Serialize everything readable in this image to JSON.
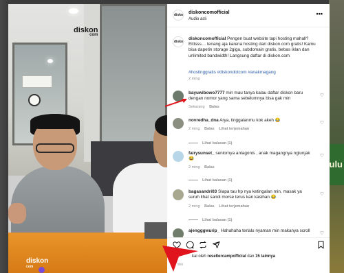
{
  "photo": {
    "logo_top": "diskon",
    "logo_top_sub": "com",
    "logo_bottom": "diskon",
    "logo_bottom_sub": "com"
  },
  "backdrop": {
    "right_text": "ulu"
  },
  "header": {
    "avatar_text": "diskon",
    "username": "diskoncomofficial",
    "subtitle": "Audio asli",
    "more_icon": "more-horizontal-icon",
    "more_label": "•••"
  },
  "caption": {
    "avatar_text": "diskon",
    "username": "diskoncomofficial",
    "text": " Pengen buat website tapi hosting mahall? Eittsss… tenang aja karena hosting dari diskon.com gratis! Kamu bisa dapetin storage 2giga, subdomain gratis, bebas iklan dan unlimited bandwidth! Langsung daftar di diskon.com",
    "hashtags": "#hostinggratis #diskondotcom #anakmagang",
    "time": "2 ming"
  },
  "comments": [
    {
      "username": "bayuwibowo7777",
      "text": " min mau tanya kalau daftar diskon baru dengan nomor yang sama sebelumnya bisa gak min",
      "time": "Sekarang",
      "reply": "Balas",
      "likes": "",
      "translate": "",
      "view_replies": ""
    },
    {
      "username": "novredha_dna",
      "text": " Arya, tinggalanmu kok akeh 😂",
      "time": "2 ming",
      "reply": "Balas",
      "translate": "Lihat terjemahan",
      "view_replies": "Lihat balasan (1)"
    },
    {
      "username": "fairysunset_",
      "text": " seniornya antagonis , anak magangnya nglunjak 😂",
      "time": "2 ming",
      "reply": "Balas",
      "translate": "",
      "view_replies": "Lihat balasan (1)"
    },
    {
      "username": "bagasandri03",
      "text": " Siapa tau hp nya ketingalan min, masak ya suruh lihat sandi morse terus kan kasihan 😂",
      "time": "2 ming",
      "reply": "Balas",
      "translate": "Lihat terjemahan",
      "view_replies": "Lihat balasan (1)"
    },
    {
      "username": "ajengggwurip_",
      "text": " Hahahaha terlalu nyaman min makanya scroll",
      "time": "",
      "reply": "",
      "translate": "",
      "view_replies": ""
    }
  ],
  "actions": {
    "like_icon": "heart-icon",
    "comment_icon": "comment-icon",
    "repost_icon": "repost-icon",
    "share_icon": "send-icon",
    "save_icon": "bookmark-icon",
    "liked_prefix": "kai oleh ",
    "liked_user": "resellercampofficial",
    "liked_mid": " dan ",
    "liked_count": "15 lainnya",
    "liked_time": "Mei"
  },
  "colors": {
    "annotation_red": "#e0141c",
    "hashtag_blue": "#2b5ba8",
    "muted_grey": "#8e8e8e"
  }
}
